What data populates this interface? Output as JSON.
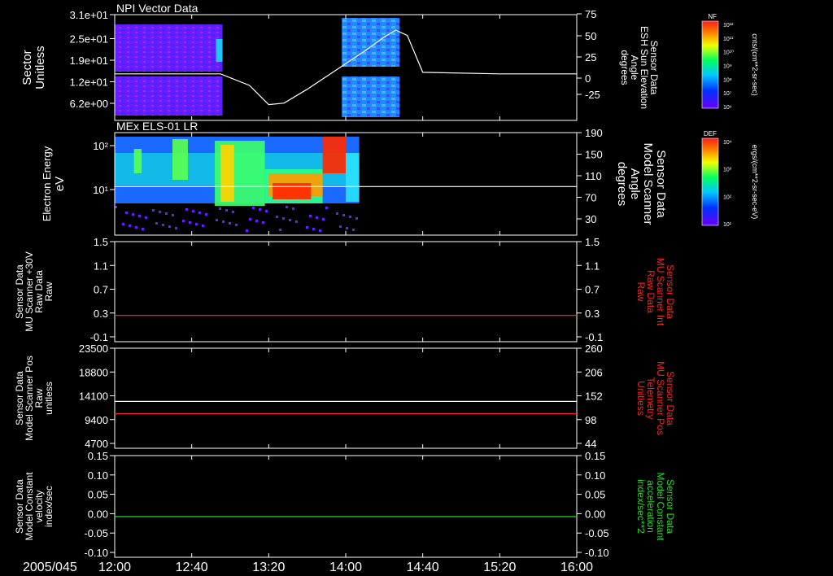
{
  "date_label": "2005/045",
  "time_ticks": [
    "12:00",
    "12:40",
    "13:20",
    "14:00",
    "14:40",
    "15:20",
    "16:00"
  ],
  "colors": {
    "background": "#000000",
    "axis": "#ffffff",
    "red_trace": "#ff2020",
    "green_trace": "#22dd22",
    "white_trace": "#ffffff"
  },
  "colorbars": [
    {
      "label": "NF",
      "unit": "cnts/(cm**2-sr-sec)",
      "ticks": [
        "10¹²",
        "10¹¹",
        "10¹⁰",
        "10⁹",
        "10⁸",
        "10⁷",
        "10⁶"
      ]
    },
    {
      "label": "DEF",
      "unit": "ergs/(cm**2-sr-sec-eV)",
      "ticks": [
        "10⁴",
        "10³",
        "10²",
        "10¹"
      ]
    }
  ],
  "chart_data": [
    {
      "type": "heatmap",
      "title": "NPI Vector Data",
      "ylabel_left": [
        "Sector",
        "Unitless"
      ],
      "ylabel_right": [
        "Sensor Data",
        "ESH Sun Elevation",
        "Angle",
        "degrees"
      ],
      "left_ticks": [
        "3.1e+01",
        "2.5e+01",
        "1.9e+01",
        "1.2e+01",
        "6.2e+00"
      ],
      "right_ticks": [
        "75",
        "50",
        "25",
        "0",
        "-25"
      ],
      "right_range": [
        -50,
        75
      ],
      "series": [
        {
          "name": "ESH Sun Elevation Angle",
          "color": "#ffffff",
          "x": [
            "12:00",
            "12:30",
            "12:55",
            "13:10",
            "13:20",
            "13:28",
            "13:40",
            "13:55",
            "14:10",
            "14:20",
            "14:26",
            "14:32",
            "14:40",
            "15:20",
            "16:00"
          ],
          "y": [
            0,
            0,
            0,
            -15,
            -40,
            -38,
            -20,
            5,
            30,
            48,
            57,
            50,
            2,
            0,
            0
          ]
        }
      ],
      "data_blocks": [
        {
          "x": [
            "12:00",
            "12:56"
          ],
          "color_level": "low-mid"
        },
        {
          "x": [
            "13:58",
            "14:28"
          ],
          "color_level": "mid"
        }
      ]
    },
    {
      "type": "heatmap",
      "title": "MEx ELS-01 LR",
      "ylabel_left": [
        "Electron Energy",
        "eV"
      ],
      "ylabel_right": [
        "Sensor Data",
        "Model Scanner",
        "Angle",
        "degrees"
      ],
      "left_ticks": [
        "10²",
        "10¹"
      ],
      "right_ticks": [
        "190",
        "150",
        "110",
        "70",
        "30"
      ],
      "right_range": [
        0,
        190
      ],
      "series": [
        {
          "name": "Model Scanner Angle",
          "color": "#ffffff",
          "x": [
            "12:00",
            "16:00"
          ],
          "y": [
            90,
            90
          ]
        }
      ],
      "data_blocks": [
        {
          "x": [
            "12:00",
            "14:07"
          ],
          "color_level": "spectrogram"
        }
      ]
    },
    {
      "type": "line",
      "ylabel_left": [
        "Sensor Data",
        "MU Scanner +30V",
        "Raw Data",
        "Raw"
      ],
      "ylabel_right": [
        "Sensor Data",
        "MU Scanner Int",
        "Raw Data",
        "Raw"
      ],
      "left_ticks": [
        "1.5",
        "1.1",
        "0.7",
        "0.3",
        "-0.1"
      ],
      "right_ticks": [
        "1.5",
        "1.1",
        "0.7",
        "0.3",
        "-0.1"
      ],
      "ylim": [
        -0.4,
        1.5
      ],
      "series": [
        {
          "name": "MU Scanner Int",
          "color": "#ff2020",
          "x": [
            "12:00",
            "16:00"
          ],
          "y": [
            0.1,
            0.1
          ]
        }
      ]
    },
    {
      "type": "line",
      "ylabel_left": [
        "Sensor Data",
        "Model Scanner Pos",
        "Raw",
        "unitless"
      ],
      "ylabel_right": [
        "Sensor Data",
        "MU Scanner Pos",
        "Telemetry",
        "Unitless"
      ],
      "left_ticks": [
        "23500",
        "18800",
        "14100",
        "9400",
        "4700"
      ],
      "right_ticks": [
        "260",
        "206",
        "152",
        "98",
        "44"
      ],
      "ylim_left": [
        0,
        23500
      ],
      "ylim_right": [
        0,
        260
      ],
      "series": [
        {
          "name": "Model Scanner Pos",
          "color": "#ffffff",
          "x": [
            "12:00",
            "16:00"
          ],
          "y": [
            11000,
            11000
          ]
        },
        {
          "name": "MU Scanner Pos",
          "color": "#ff2020",
          "x": [
            "12:00",
            "16:00"
          ],
          "y": [
            90,
            90
          ]
        }
      ]
    },
    {
      "type": "line",
      "ylabel_left": [
        "Sensor Data",
        "Model Constant",
        "velocity",
        "index/sec"
      ],
      "ylabel_right": [
        "Sensor Data",
        "Model Constant",
        "acceleration",
        "index/sec**2"
      ],
      "left_ticks": [
        "0.15",
        "0.10",
        "0.05",
        "0.00",
        "-0.05",
        "-0.10"
      ],
      "right_ticks": [
        "0.15",
        "0.10",
        "0.05",
        "0.00",
        "-0.05",
        "-0.10"
      ],
      "ylim": [
        -0.1,
        0.15
      ],
      "series": [
        {
          "name": "Model Constant acceleration",
          "color": "#22dd22",
          "x": [
            "12:00",
            "16:00"
          ],
          "y": [
            0,
            0
          ]
        }
      ]
    }
  ]
}
